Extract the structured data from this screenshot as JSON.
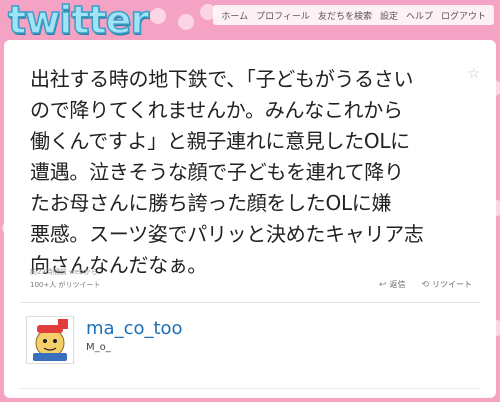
{
  "header": {
    "logo_text": "twitter",
    "nav": [
      "ホーム",
      "プロフィール",
      "友だちを検索",
      "設定",
      "ヘルプ",
      "ログアウト"
    ]
  },
  "tweet": {
    "text": "出社する時の地下鉄で、「子どもがうるさい\nので降りてくれませんか。みんなこれから\n働くんですよ」と親子連れに意見したOLに\n遭遇。泣きそうな顔で子どもを連れて降り\nたお母さんに勝ち誇った顔をしたOLに嫌\n悪感。スーツ姿でパリッと決めたキャリア志\n向さんなんだなぁ。",
    "timestamp": "約23時間前 webから",
    "retweet_count": "100+人 がリツイート",
    "reply_label": "返信",
    "retweet_label": "リツイート"
  },
  "author": {
    "username": "ma_co_too",
    "realname": "M_o_"
  },
  "icons": {
    "star": "star-icon",
    "reply": "reply-icon",
    "retweet": "retweet-icon"
  },
  "colors": {
    "background": "#f5a3c4",
    "link": "#1d6fb8",
    "logo": "#9fe3f5"
  }
}
